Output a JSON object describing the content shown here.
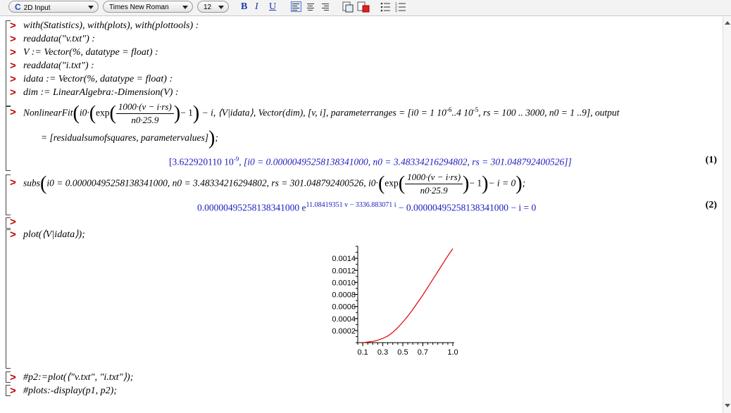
{
  "toolbar": {
    "mode": "2D Input",
    "font": "Times New Roman",
    "size": "12",
    "bold": "B",
    "italic": "I",
    "underline": "U"
  },
  "commands": {
    "c1": "with(Statistics), with(plots), with(plottools) :",
    "c2": "readdata(\"v.txt\") :",
    "c3": "V := Vector(%, datatype = float) :",
    "c4": "readdata(\"i.txt\") :",
    "c5": "idata := Vector(%, datatype = float) :",
    "c6": "dim := LinearAlgebra:-Dimension(V) :",
    "c7a": "NonlinearFit",
    "c7b": "i0·",
    "c7exp": "exp",
    "c7num": "1000·(v − i·rs)",
    "c7den": "n0·25.9",
    "c7c": "− 1",
    "c7d": "− i, ⟨V|idata⟩, Vector(dim), [v, i], parameterranges = [i0 = 1 10",
    "c7e": "-6",
    "c7f": "..4 10",
    "c7g": "-5",
    "c7h": ", rs = 100 .. 3000, n0 = 1 ..9], output",
    "c7i": "= [residualsumofsquares, parametervalues]",
    "c7j": ";",
    "c8a": "subs",
    "c8b": "i0 = 0.00000495258138341000, n0 = 3.48334216294802, rs = 301.048792400526, i0·",
    "c8exp": "exp",
    "c8num": "1000·(v − i·rs)",
    "c8den": "n0·25.9",
    "c8c": "− 1",
    "c8d": "− i = 0",
    "c8e": ";",
    "c9": "plot(⟨V|idata⟩);",
    "c10": "#p2:=plot(⟨\"v.txt\", \"i.txt\"⟩);",
    "c11": "#plots:-display(p1, p2);"
  },
  "outputs": {
    "o1a": "[3.622920110 10",
    "o1b": "-9",
    "o1c": ", [i0 = 0.00000495258138341000, n0 = 3.48334216294802, rs = 301.048792400526]]",
    "o1num": "(1)",
    "o2a": "0.00000495258138341000 e",
    "o2b": "11.08419351 v − 3336.883071 i",
    "o2c": " − 0.00000495258138341000 − i = 0",
    "o2num": "(2)"
  },
  "chart_data": {
    "type": "line",
    "x": [
      0.1,
      0.15,
      0.2,
      0.25,
      0.3,
      0.35,
      0.4,
      0.45,
      0.5,
      0.55,
      0.6,
      0.65,
      0.7,
      0.75,
      0.8,
      0.85,
      0.9,
      0.95,
      1.0
    ],
    "series": [
      {
        "values": [
          0.0,
          1e-05,
          2e-05,
          4e-05,
          7e-05,
          0.00011,
          0.00017,
          0.00025,
          0.00034,
          0.00044,
          0.00055,
          0.00067,
          0.00079,
          0.00092,
          0.00105,
          0.00118,
          0.00131,
          0.00144,
          0.00156
        ],
        "color": "#e00000"
      }
    ],
    "xticks": [
      "0.1",
      "0.3",
      "0.5",
      "0.7",
      "1.0"
    ],
    "yticks": [
      "0.0002",
      "0.0004",
      "0.0006",
      "0.0008",
      "0.0010",
      "0.0012",
      "0.0014"
    ],
    "xlim": [
      0.05,
      1.0
    ],
    "ylim": [
      0,
      0.0016
    ],
    "grid": false
  }
}
